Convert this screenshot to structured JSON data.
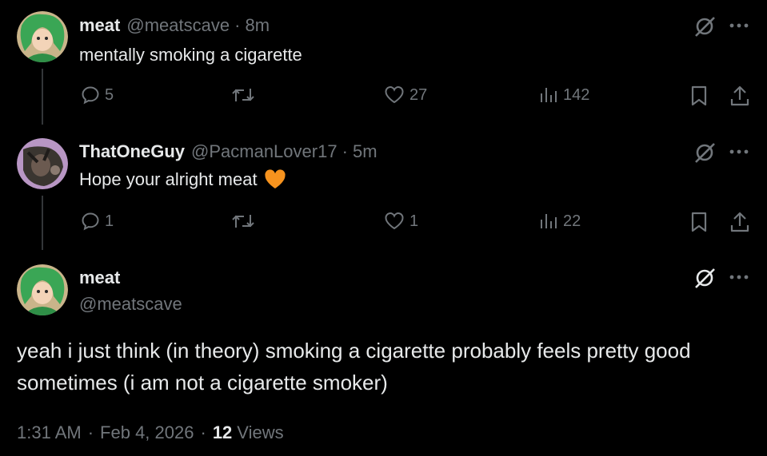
{
  "colors": {
    "background": "#000000",
    "text": "#e7e9ea",
    "muted": "#71767b",
    "thread_line": "#333639",
    "heart_emoji": "#f7931e"
  },
  "reply1": {
    "display_name": "meat",
    "handle": "@meatscave",
    "time": "· 8m",
    "text": "mentally smoking a cigarette",
    "stats": {
      "replies": "5",
      "likes": "27",
      "views": "142"
    }
  },
  "reply2": {
    "display_name": "ThatOneGuy",
    "handle": "@PacmanLover17",
    "time": "· 5m",
    "text": "Hope your alright meat",
    "emoji": "orange-heart",
    "stats": {
      "replies": "1",
      "likes": "1",
      "views": "22"
    }
  },
  "main": {
    "display_name": "meat",
    "handle": "@meatscave",
    "text": "yeah i just think (in theory) smoking a cigarette probably feels pretty good sometimes (i am not a cigarette smoker)",
    "time": "1:31 AM",
    "separator": "·",
    "date": "Feb 4, 2026",
    "views_count": "12",
    "views_label": "Views"
  },
  "icons": [
    "grok-slash-icon",
    "more-icon",
    "reply-icon",
    "retweet-icon",
    "like-icon",
    "views-icon",
    "bookmark-icon",
    "share-icon"
  ]
}
